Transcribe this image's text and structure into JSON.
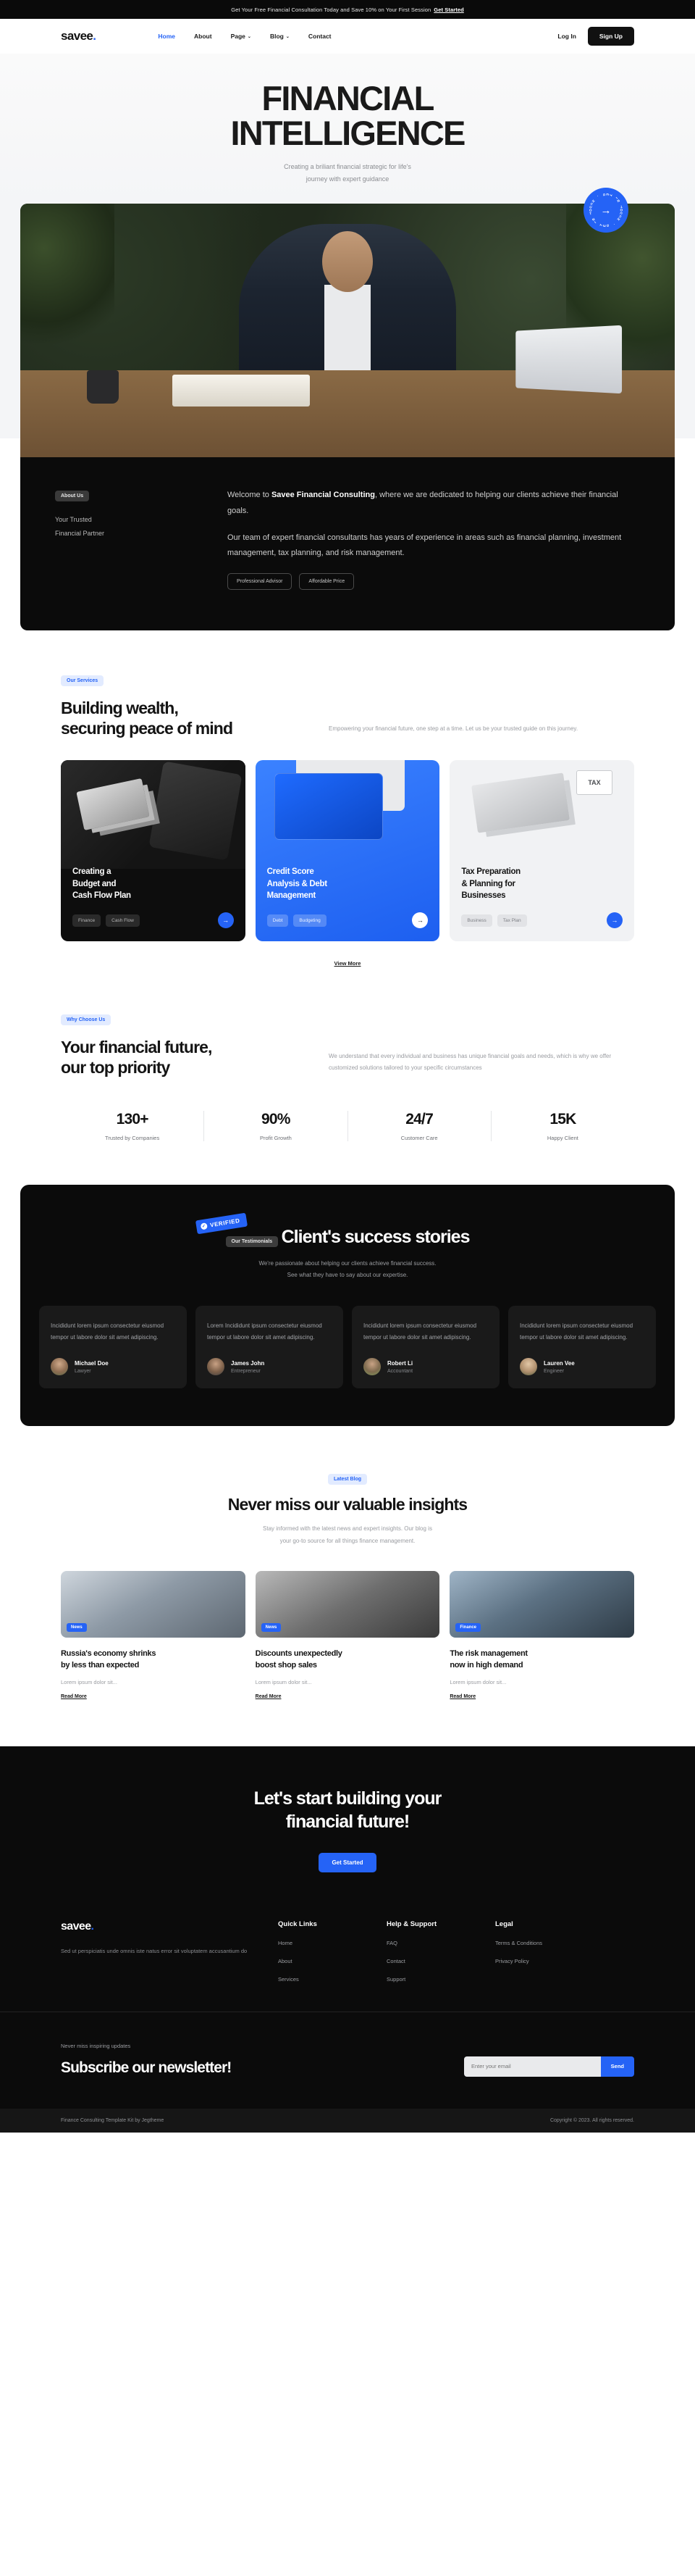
{
  "announcement": {
    "text": "Get Your Free Financial Consultation Today and Save 10% on Your First Session",
    "cta": "Get Started"
  },
  "nav": {
    "logo": "savee",
    "logo_dot": ".",
    "links": [
      {
        "label": "Home",
        "active": true,
        "caret": ""
      },
      {
        "label": "About",
        "active": false,
        "caret": ""
      },
      {
        "label": "Page",
        "active": false,
        "caret": "⌄"
      },
      {
        "label": "Blog",
        "active": false,
        "caret": "⌄"
      },
      {
        "label": "Contact",
        "active": false,
        "caret": ""
      }
    ],
    "login": "Log In",
    "signup": "Sign Up"
  },
  "hero": {
    "title_line1": "FINANCIAL",
    "title_line2": "INTELLIGENCE",
    "subtitle_line1": "Creating a briliant financial strategic for life's",
    "subtitle_line2": "journey with expert guidance",
    "badge_ring": "GET IN TOUCH · GET IN TOUCH · ",
    "badge_arrow": "→"
  },
  "about": {
    "pill": "About Us",
    "heading_line1": "Your Trusted",
    "heading_line2": "Financial Partner",
    "paragraph1_pre": "Welcome to ",
    "paragraph1_bold": "Savee Financial Consulting",
    "paragraph1_post": ", where we are dedicated to helping our clients achieve their financial goals.",
    "paragraph2": "Our team of expert financial consultants has years of experience in areas such as financial planning, investment management, tax planning, and risk management.",
    "tags": [
      "Professional Advisor",
      "Affordable Price"
    ]
  },
  "services": {
    "pill": "Our Services",
    "heading_line1": "Building wealth,",
    "heading_line2": "securing peace of mind",
    "description": "Empowering your financial future, one step at a time. Let us be your trusted guide on this journey.",
    "view_more": "View More",
    "cards": [
      {
        "title_line1": "Creating a",
        "title_line2": "Budget and",
        "title_line3": "Cash Flow Plan",
        "chips": [
          "Finance",
          "Cash Flow"
        ],
        "arrow": "→"
      },
      {
        "title_line1": "Credit Score",
        "title_line2": "Analysis & Debt",
        "title_line3": "Management",
        "chips": [
          "Debt",
          "Budgeting"
        ],
        "arrow": "→"
      },
      {
        "title_line1": "Tax Preparation",
        "title_line2": "& Planning for",
        "title_line3": "Businesses",
        "chips": [
          "Business",
          "Tax Plan"
        ],
        "arrow": "→",
        "art_label": "TAX"
      }
    ]
  },
  "why": {
    "pill": "Why Choose Us",
    "heading_line1": "Your financial future,",
    "heading_line2": "our top priority",
    "description": "We understand that every individual and business has unique financial goals and needs, which is why we offer customized solutions tailored to your specific circumstances",
    "stats": [
      {
        "value": "130+",
        "label": "Trusted by Companies"
      },
      {
        "value": "90%",
        "label": "Profit Growth"
      },
      {
        "value": "24/7",
        "label": "Customer Care"
      },
      {
        "value": "15K",
        "label": "Happy Client"
      }
    ]
  },
  "testimonials": {
    "pill": "Our Testimonials",
    "verified_badge": "VERIFIED",
    "verified_tick": "✓",
    "heading": "Client's success stories",
    "sub_line1": "We're passionate about helping our clients achieve financial success.",
    "sub_line2": "See what they have to say about our expertise.",
    "cards": [
      {
        "quote": "Incididunt lorem ipsum consectetur eiusmod tempor ut labore dolor sit amet adipiscing.",
        "name": "Michael Doe",
        "role": "Lawyer"
      },
      {
        "quote": "Lorem Incididunt ipsum consectetur eiusmod tempor ut labore dolor sit amet adipiscing.",
        "name": "James John",
        "role": "Entrepreneur"
      },
      {
        "quote": "Incididunt lorem ipsum consectetur eiusmod tempor ut labore dolor sit amet adipiscing.",
        "name": "Robert Li",
        "role": "Accountant"
      },
      {
        "quote": "Incididunt lorem ipsum consectetur eiusmod tempor ut labore dolor sit amet adipiscing.",
        "name": "Lauren Vee",
        "role": "Engineer"
      }
    ]
  },
  "blog": {
    "pill": "Latest Blog",
    "heading": "Never miss our valuable insights",
    "sub_line1": "Stay informed with the latest news and expert insights. Our blog is",
    "sub_line2": "your go-to source for all things finance management.",
    "posts": [
      {
        "tag": "News",
        "title_line1": "Russia's economy shrinks",
        "title_line2": "by less than expected",
        "excerpt": "Lorem ipsum dolor sit...",
        "read_more": "Read More"
      },
      {
        "tag": "News",
        "title_line1": "Discounts unexpectedly",
        "title_line2": "boost shop sales",
        "excerpt": "Lorem ipsum dolor sit...",
        "read_more": "Read More"
      },
      {
        "tag": "Finance",
        "title_line1": "The risk management",
        "title_line2": "now in high demand",
        "excerpt": "Lorem ipsum dolor sit...",
        "read_more": "Read More"
      }
    ]
  },
  "cta": {
    "heading_line1": "Let's start building your",
    "heading_line2": "financial future!",
    "button": "Get Started"
  },
  "footer": {
    "logo": "savee",
    "logo_dot": ".",
    "about": "Sed ut perspiciatis unde omnis iste natus error sit voluptatem accusantium do",
    "columns": [
      {
        "title": "Quick Links",
        "links": [
          "Home",
          "About",
          "Services"
        ]
      },
      {
        "title": "Help & Support",
        "links": [
          "FAQ",
          "Contact",
          "Support"
        ]
      },
      {
        "title": "Legal",
        "links": [
          "Terms & Conditions",
          "Privacy Policy"
        ]
      }
    ],
    "newsletter": {
      "kicker": "Never miss inspiring updates",
      "heading": "Subscribe our newsletter!",
      "placeholder": "Enter your email",
      "value": "",
      "button": "Send"
    },
    "credit": "Finance Consulting Template Kit by Jegtheme",
    "copyright": "Copyright © 2023. All rights reserved."
  },
  "colors": {
    "accent": "#2563f6",
    "dark": "#0b0b0b",
    "light": "#f4f5f7"
  }
}
